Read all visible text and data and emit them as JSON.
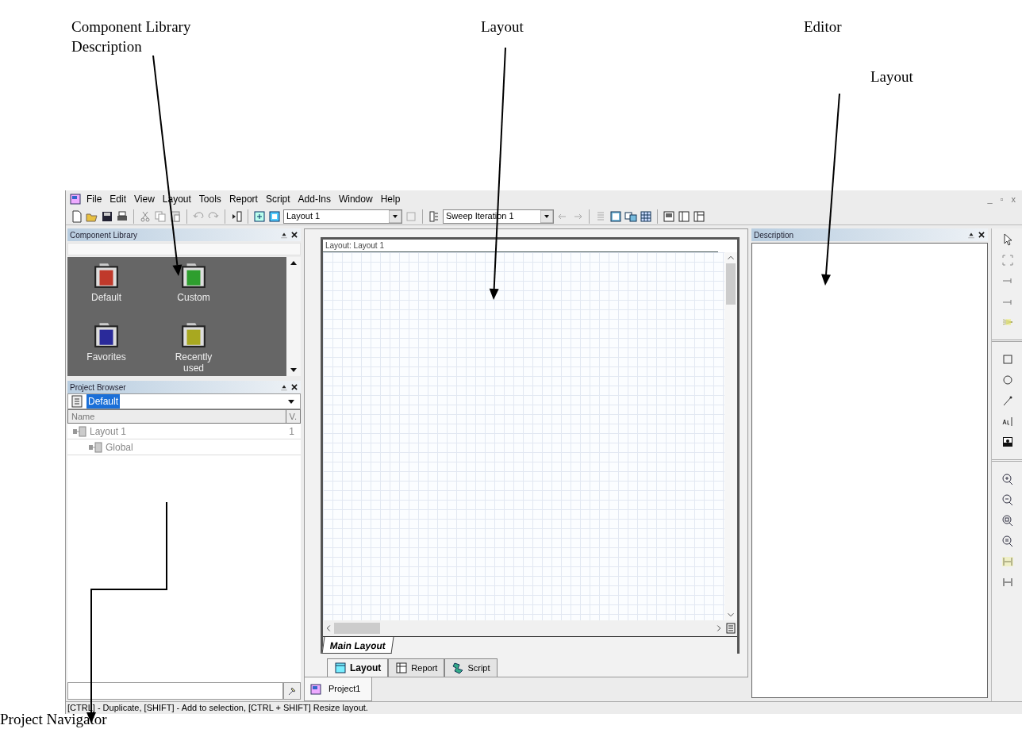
{
  "annotations": [
    {
      "text": "Component Library"
    },
    {
      "text": "Description"
    },
    {
      "text": "Layout"
    },
    {
      "text": "Editor"
    },
    {
      "text": "Layout"
    },
    {
      "text": "Project Navigator"
    }
  ],
  "menu": [
    "File",
    "Edit",
    "View",
    "Layout",
    "Tools",
    "Report",
    "Script",
    "Add-Ins",
    "Window",
    "Help"
  ],
  "window_controls": [
    "_",
    "▫",
    "x"
  ],
  "toolbar": {
    "layout_combo": "Layout 1",
    "sweep_combo": "Sweep Iteration 1"
  },
  "component_library": {
    "title": "Component Library",
    "folders": [
      {
        "label": "Default",
        "color": "#c0392b"
      },
      {
        "label": "Custom",
        "color": "#2e9e2e"
      },
      {
        "label": "Favorites",
        "color": "#2a2a9a"
      },
      {
        "label": "Recently used",
        "color": "#a8a820"
      }
    ]
  },
  "project_browser": {
    "title": "Project Browser",
    "selector": {
      "value": "Default",
      "selected": true
    },
    "columns": [
      "Name",
      "V."
    ],
    "tree": [
      {
        "name": "Layout 1",
        "version": "1",
        "children": [
          {
            "name": "Global"
          }
        ]
      }
    ]
  },
  "editor": {
    "title": "Layout: Layout 1",
    "sheet_tab": "Main Layout",
    "view_tabs": [
      {
        "label": "Layout",
        "selected": true
      },
      {
        "label": "Report",
        "selected": false
      },
      {
        "label": "Script",
        "selected": false
      }
    ],
    "document_tab": "Project1"
  },
  "description": {
    "title": "Description"
  },
  "status_bar": "[CTRL] - Duplicate, [SHIFT] - Add to selection, [CTRL + SHIFT] Resize layout."
}
